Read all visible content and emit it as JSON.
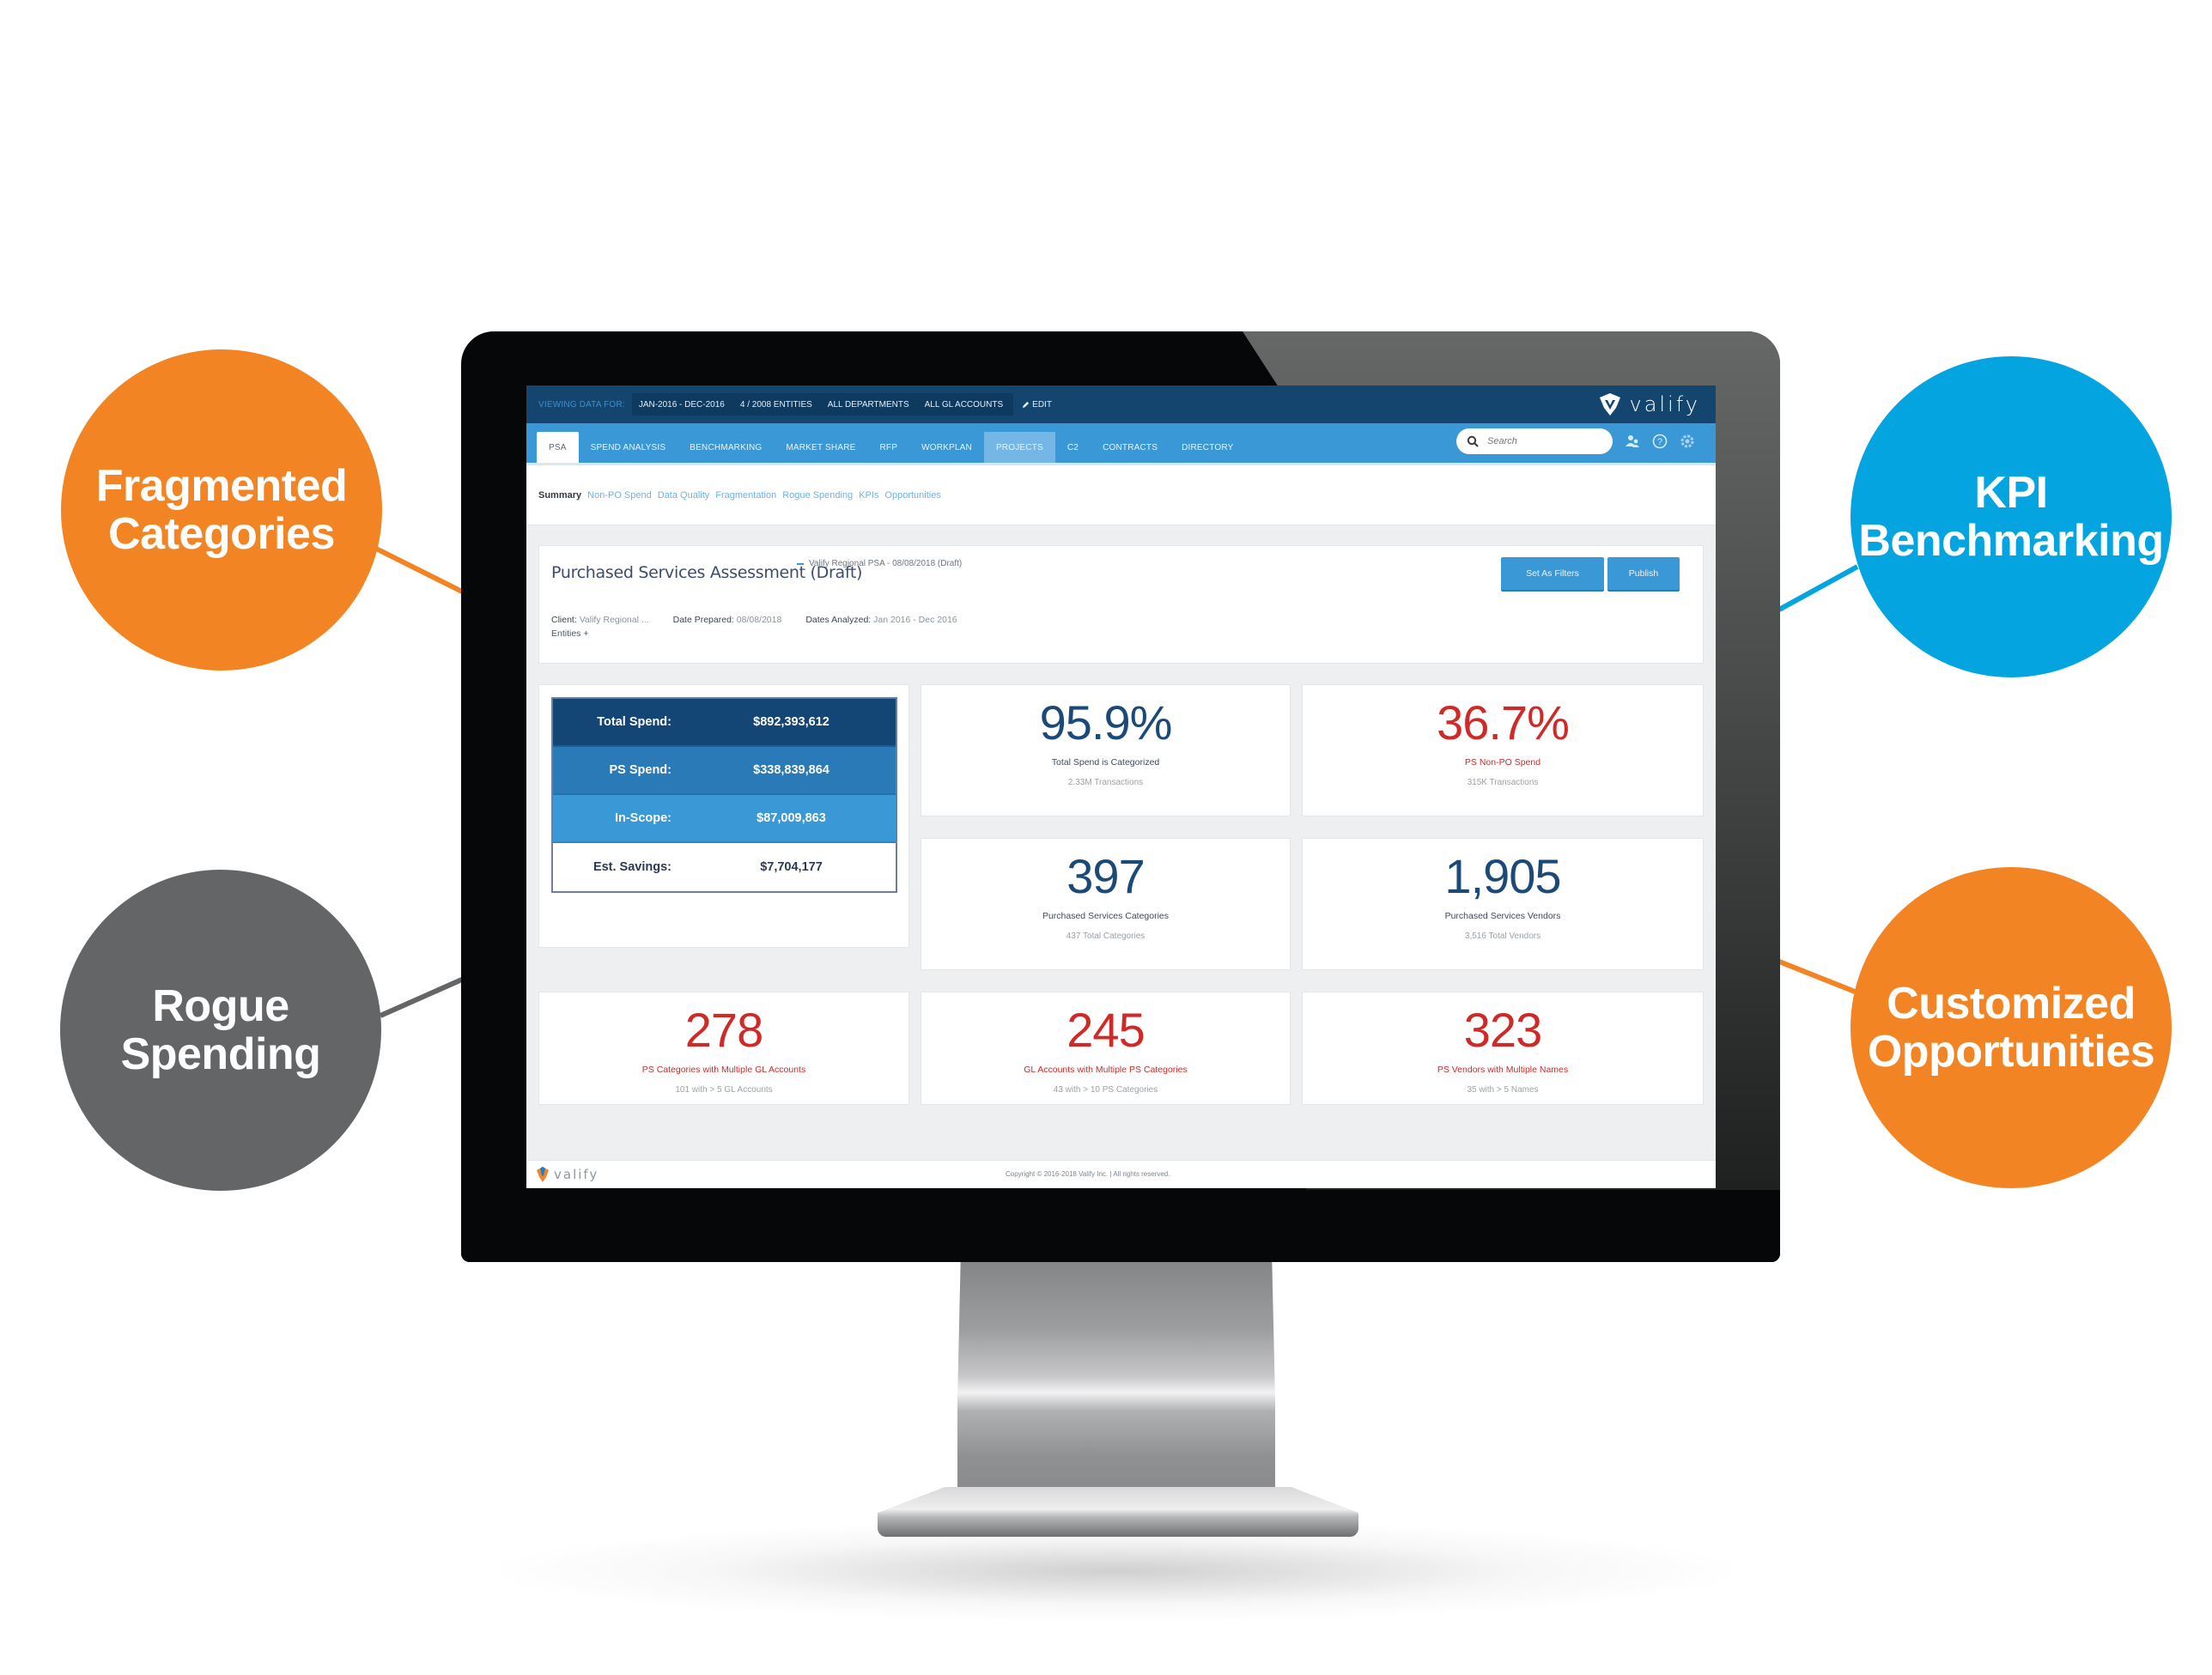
{
  "bubbles": {
    "fragmented": [
      "Fragmented",
      "Categories"
    ],
    "rogue": [
      "Rogue",
      "Spending"
    ],
    "kpi": [
      "KPI",
      "Benchmarking"
    ],
    "customized": [
      "Customized",
      "Opportunities"
    ]
  },
  "colors": {
    "orange": "#f28423",
    "gray": "#646567",
    "blue": "#04a4e1",
    "app_dark_blue": "#13456f",
    "app_blue": "#3a98d6",
    "kpi_red": "#cf2a27",
    "kpi_navy": "#1c4a78"
  },
  "app": {
    "filter_label": "VIEWING DATA FOR:",
    "filters": [
      "JAN-2016 - DEC-2016",
      "4 / 2008 ENTITIES",
      "ALL DEPARTMENTS",
      "ALL GL ACCOUNTS"
    ],
    "edit_label": "EDIT",
    "logo_text": "valify",
    "nav_tabs": [
      "PSA",
      "SPEND ANALYSIS",
      "BENCHMARKING",
      "MARKET SHARE",
      "RFP",
      "WORKPLAN",
      "PROJECTS",
      "C2",
      "CONTRACTS",
      "DIRECTORY"
    ],
    "search_placeholder": "Search",
    "nav_icons": [
      "users-icon",
      "help-icon",
      "settings-icon"
    ],
    "subnav": [
      "Summary",
      "Non-PO Spend",
      "Data Quality",
      "Fragmentation",
      "Rogue Spending",
      "KPIs",
      "Opportunities"
    ],
    "assessment": {
      "title": "Purchased Services Assessment (Draft)",
      "version": "Valify Regional PSA - 08/08/2018 (Draft)",
      "client_label": "Client:",
      "client_value": "Valify Regional ...",
      "date_prepared_label": "Date Prepared:",
      "date_prepared_value": "08/08/2018",
      "dates_analyzed_label": "Dates Analyzed:",
      "dates_analyzed_value": "Jan 2016 - Dec 2016",
      "entities_label": "Entities +",
      "set_filters_button": "Set As Filters",
      "publish_button": "Publish"
    },
    "summary": [
      {
        "label": "Total Spend:",
        "value": "$892,393,612"
      },
      {
        "label": "PS Spend:",
        "value": "$338,839,864"
      },
      {
        "label": "In-Scope:",
        "value": "$87,009,863"
      },
      {
        "label": "Est. Savings:",
        "value": "$7,704,177"
      }
    ],
    "kpis": [
      {
        "value": "95.9%",
        "label": "Total Spend is Categorized",
        "sub": "2.33M Transactions"
      },
      {
        "value": "36.7%",
        "label": "PS Non-PO Spend",
        "sub": "315K Transactions"
      },
      {
        "value": "397",
        "label": "Purchased Services Categories",
        "sub": "437 Total Categories"
      },
      {
        "value": "1,905",
        "label": "Purchased Services Vendors",
        "sub": "3,516 Total Vendors"
      },
      {
        "value": "278",
        "label": "PS Categories with Multiple GL Accounts",
        "sub": "101 with > 5 GL Accounts"
      },
      {
        "value": "245",
        "label": "GL Accounts with Multiple PS Categories",
        "sub": "43 with > 10 PS Categories"
      },
      {
        "value": "323",
        "label": "PS Vendors with Multiple Names",
        "sub": "35 with > 5 Names"
      }
    ],
    "footer": {
      "logo_text": "valify",
      "copyright": "Copyright © 2016-2018 Valify Inc. | All rights reserved."
    }
  }
}
